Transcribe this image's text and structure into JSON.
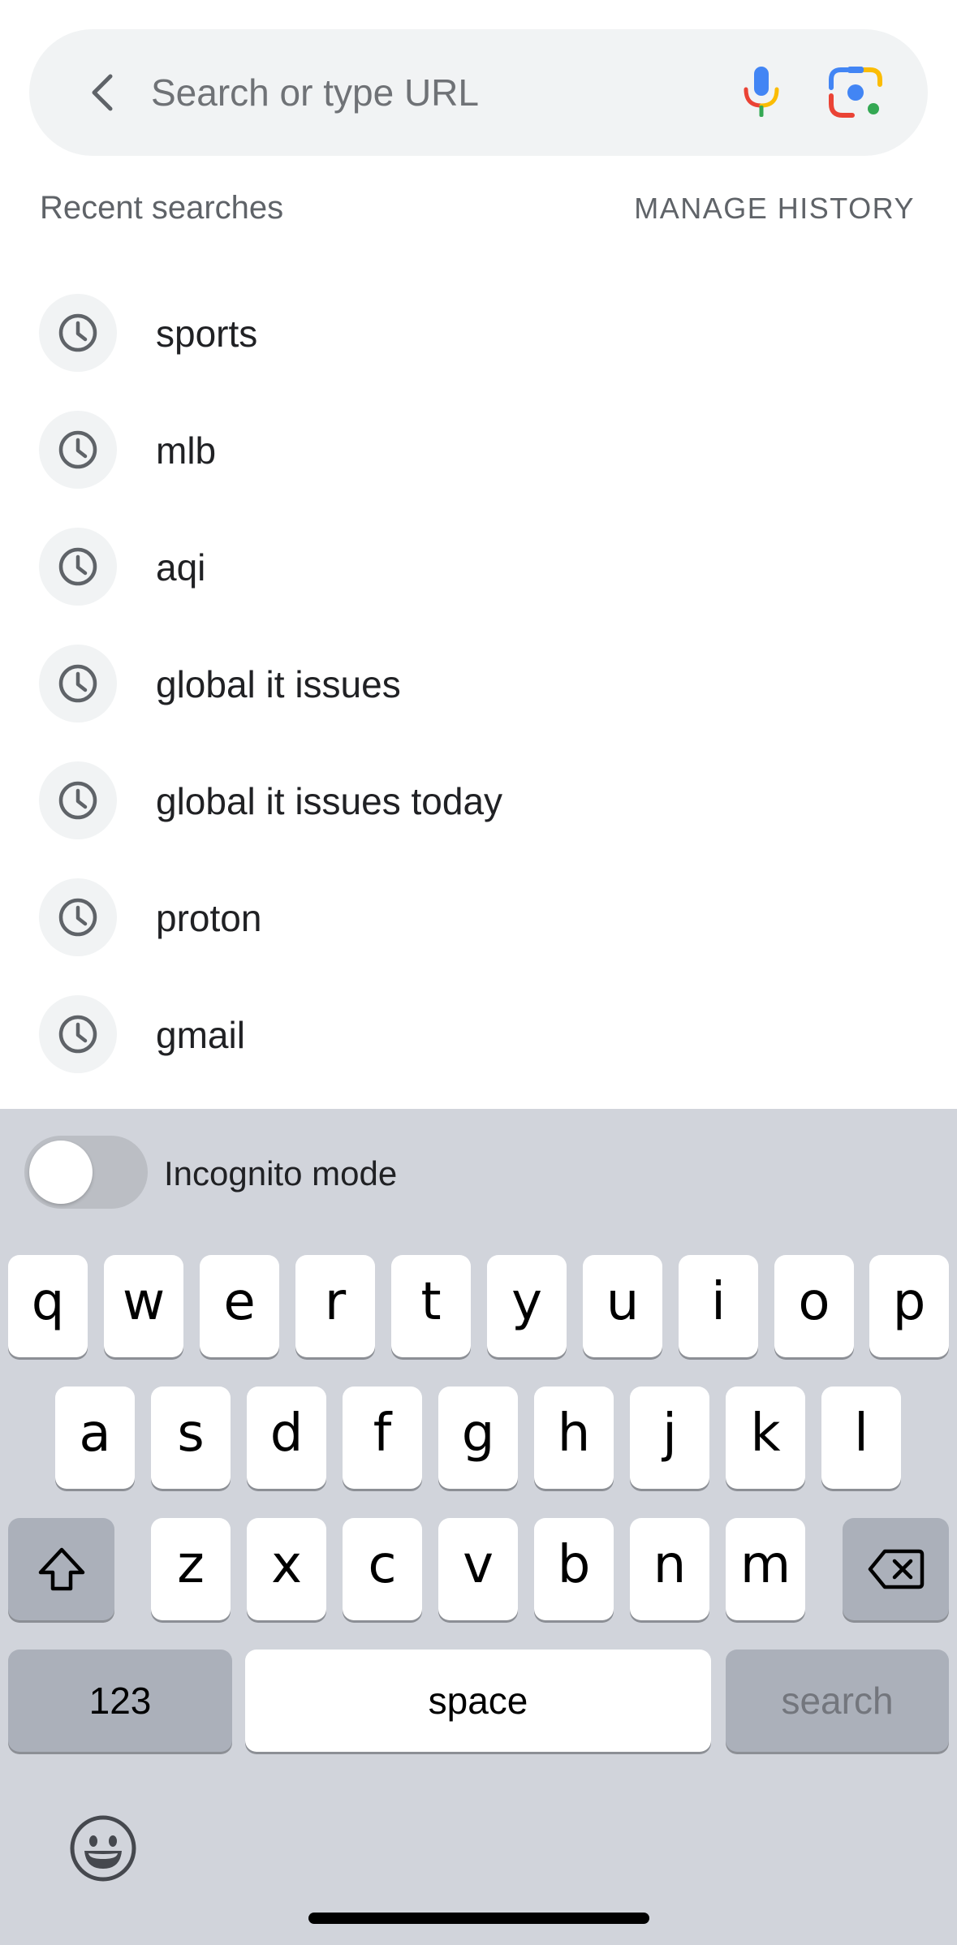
{
  "search": {
    "placeholder": "Search or type URL",
    "value": ""
  },
  "icons": {
    "back": "chevron-left-icon",
    "voice": "microphone-icon",
    "lens": "google-lens-icon",
    "history": "clock-icon",
    "shift": "shift-arrow-icon",
    "delete": "backspace-icon",
    "emoji": "emoji-face-icon"
  },
  "header": {
    "recent_label": "Recent searches",
    "manage_history_label": "MANAGE HISTORY"
  },
  "history": [
    {
      "text": "sports"
    },
    {
      "text": "mlb"
    },
    {
      "text": "aqi"
    },
    {
      "text": "global it issues"
    },
    {
      "text": "global it issues today"
    },
    {
      "text": "proton"
    },
    {
      "text": "gmail"
    }
  ],
  "incognito": {
    "label": "Incognito mode",
    "enabled": false
  },
  "keyboard": {
    "row1": [
      "q",
      "w",
      "e",
      "r",
      "t",
      "y",
      "u",
      "i",
      "o",
      "p"
    ],
    "row2": [
      "a",
      "s",
      "d",
      "f",
      "g",
      "h",
      "j",
      "k",
      "l"
    ],
    "row3": [
      "z",
      "x",
      "c",
      "v",
      "b",
      "n",
      "m"
    ],
    "numbers_label": "123",
    "space_label": "space",
    "search_label": "search"
  },
  "colors": {
    "search_bar_bg": "#f1f3f4",
    "keyboard_bg": "#d1d4db",
    "google_blue": "#4285f4",
    "google_red": "#ea4335",
    "google_yellow": "#fbbc04",
    "google_green": "#34a853"
  }
}
